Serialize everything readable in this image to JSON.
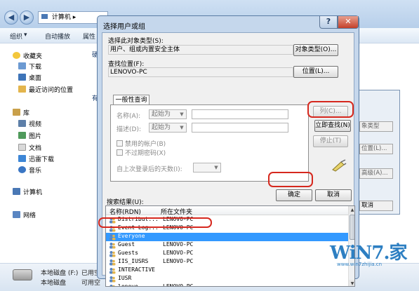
{
  "explorer": {
    "breadcrumb": "计算机",
    "toolbar": [
      "组织",
      "自动播放",
      "属性"
    ],
    "sidebar": {
      "favorites": "收藏夹",
      "items": [
        "下载",
        "桌面",
        "最近访问的位置"
      ],
      "library": "库",
      "library_items": [
        "视频",
        "图片",
        "文档",
        "迅雷下载",
        "音乐"
      ],
      "computer": "计算机",
      "network": "网络"
    },
    "content_fragments": [
      "硬",
      "有"
    ],
    "status": {
      "drive": "本地磁盘 (F:)",
      "line1": "已用空",
      "line2": "本地磁盘",
      "line3": "可用空"
    }
  },
  "secondary_dialog": {
    "buttons": [
      "象类型",
      "位置(L)...",
      "高级(A)...",
      "取消"
    ]
  },
  "dialog": {
    "title": "选择用户或组",
    "help": "?",
    "close": "✕",
    "object_type_label": "选择此对象类型(S):",
    "object_type_value": "用户、组或内置安全主体",
    "object_type_button": "对象类型(O)...",
    "location_label": "查找位置(F):",
    "location_value": "LENOVO-PC",
    "location_button": "位置(L)...",
    "tab": "一般性查询",
    "name_label": "名称(A):",
    "desc_label": "描述(D):",
    "combo_value": "起始为",
    "disabled_accounts": "禁用的帐户(B)",
    "no_expire_password": "不过期密码(X)",
    "days_since_login": "自上次登录后的天数(I):",
    "columns_button": "列(C)...",
    "find_now_button": "立即查找(N)",
    "stop_button": "停止(T)",
    "ok_button": "确定",
    "cancel_button": "取消",
    "results_label": "搜索结果(U):",
    "results_columns": [
      "名称(RDN)",
      "所在文件夹"
    ],
    "results": [
      {
        "name": "Distribut...",
        "folder": "LENOVO-PC"
      },
      {
        "name": "Event Log...",
        "folder": "LENOVO-PC"
      },
      {
        "name": "Everyone",
        "folder": "",
        "selected": true
      },
      {
        "name": "Guest",
        "folder": "LENOVO-PC"
      },
      {
        "name": "Guests",
        "folder": "LENOVO-PC"
      },
      {
        "name": "IIS_IUSRS",
        "folder": "LENOVO-PC"
      },
      {
        "name": "INTERACTIVE",
        "folder": ""
      },
      {
        "name": "IUSR",
        "folder": ""
      },
      {
        "name": "lenovo",
        "folder": "LENOVO-PC"
      }
    ]
  },
  "watermark": {
    "text": "WiN7.家",
    "url": "www.win7zhijia.cn"
  },
  "colors": {
    "highlight_red": "#d6281e",
    "selection_blue": "#3399ff",
    "dialog_frame": "#c5d7ec"
  }
}
